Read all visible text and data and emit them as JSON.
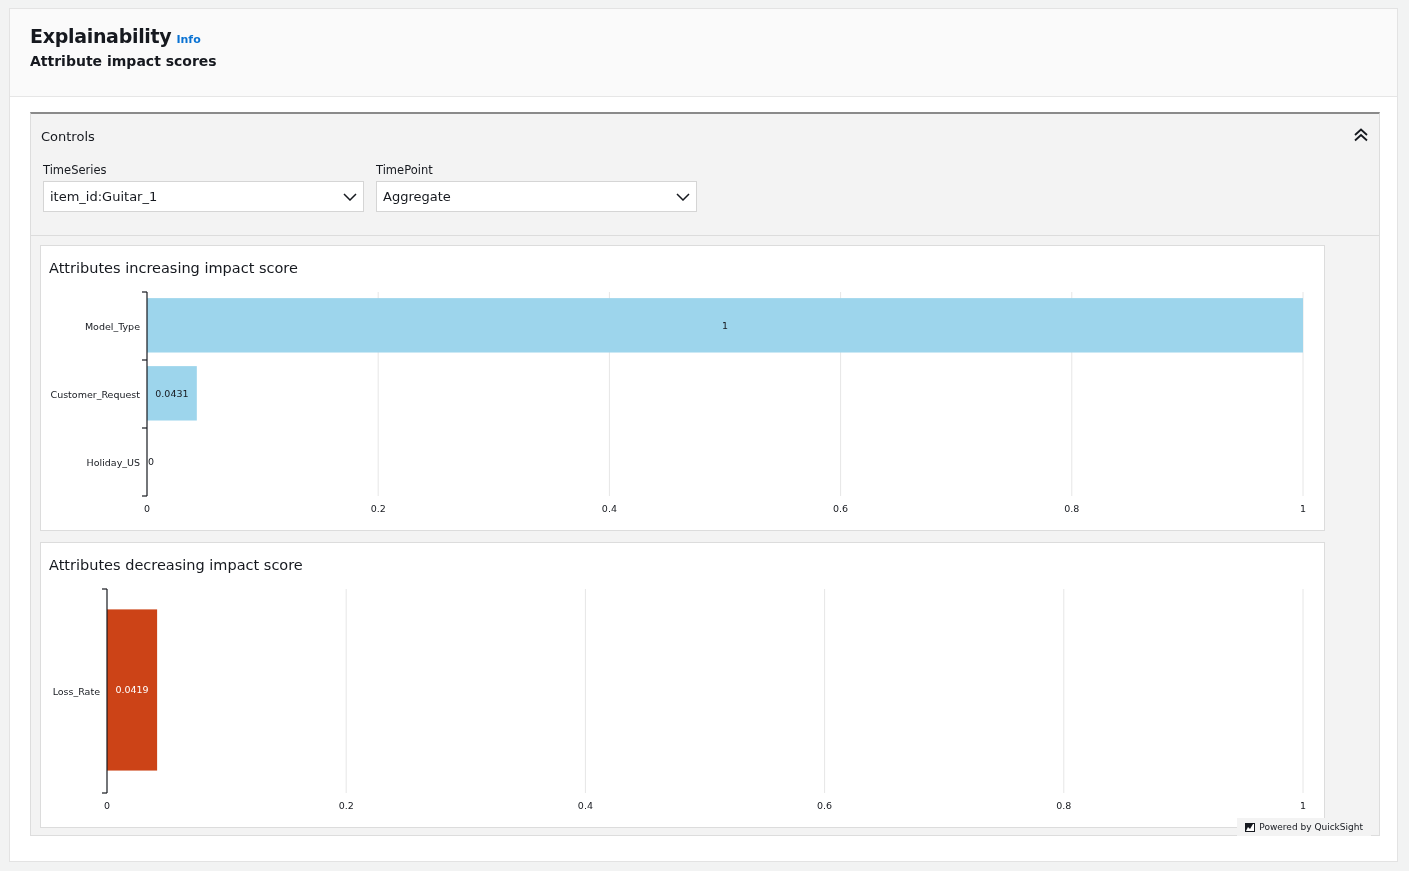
{
  "header": {
    "title": "Explainability",
    "info_link": "Info",
    "subtitle": "Attribute impact scores"
  },
  "controls": {
    "title": "Controls",
    "expanded": true,
    "dropdowns": [
      {
        "label": "TimeSeries",
        "value": "item_id:Guitar_1"
      },
      {
        "label": "TimePoint",
        "value": "Aggregate"
      }
    ]
  },
  "visuals": [
    {
      "title": "Attributes increasing impact score",
      "chart_data": {
        "type": "bar",
        "orientation": "horizontal",
        "categories": [
          "Model_Type",
          "Customer_Request",
          "Holiday_US"
        ],
        "series": [
          {
            "color": "#9dd5ec",
            "values": [
              1,
              0.0431,
              0
            ]
          }
        ],
        "xlim": [
          0,
          1
        ],
        "xticks": [
          0,
          0.2,
          0.4,
          0.6,
          0.8,
          1
        ],
        "grid": true,
        "data_labels": true
      }
    },
    {
      "title": "Attributes decreasing impact score",
      "chart_data": {
        "type": "bar",
        "orientation": "horizontal",
        "categories": [
          "Loss_Rate"
        ],
        "series": [
          {
            "color": "#cc4317",
            "values": [
              0.0419
            ]
          }
        ],
        "xlim": [
          0,
          1
        ],
        "xticks": [
          0,
          0.2,
          0.4,
          0.6,
          0.8,
          1
        ],
        "grid": true,
        "data_labels": true
      }
    }
  ],
  "badge": "Powered by QuickSight"
}
